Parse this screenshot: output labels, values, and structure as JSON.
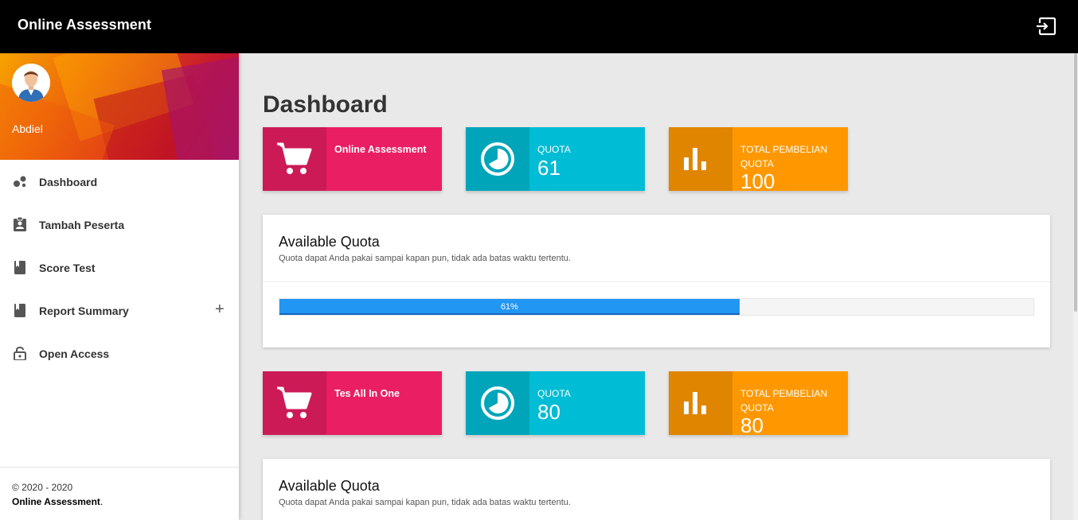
{
  "header": {
    "app_title": "Online Assessment"
  },
  "user": {
    "name": "Abdiel"
  },
  "sidebar": {
    "items": [
      {
        "label": "Dashboard"
      },
      {
        "label": "Tambah Peserta"
      },
      {
        "label": "Score Test"
      },
      {
        "label": "Report Summary",
        "expand_symbol": "+"
      },
      {
        "label": "Open Access"
      }
    ],
    "footer_copy": "© 2020 - 2020",
    "footer_brand": "Online Assessment",
    "footer_dot": "."
  },
  "main": {
    "title": "Dashboard",
    "groups": [
      {
        "product": "Online Assessment",
        "quota_label": "QUOTA",
        "quota_value": "61",
        "total_label": "TOTAL PEMBELIAN QUOTA",
        "total_value": "100",
        "card_title": "Available Quota",
        "card_subtitle": "Quota dapat Anda pakai sampai kapan pun, tidak ada batas waktu tertentu.",
        "progress_percent": 61,
        "progress_label": "61%"
      },
      {
        "product": "Tes All In One",
        "quota_label": "QUOTA",
        "quota_value": "80",
        "total_label": "TOTAL PEMBELIAN QUOTA",
        "total_value": "80",
        "card_title": "Available Quota",
        "card_subtitle": "Quota dapat Anda pakai sampai kapan pun, tidak ada batas waktu tertentu."
      }
    ]
  },
  "colors": {
    "pink": "#e91e63",
    "cyan": "#00bcd4",
    "orange": "#ff9800",
    "progress": "#2196f3",
    "topbar": "#000000"
  }
}
